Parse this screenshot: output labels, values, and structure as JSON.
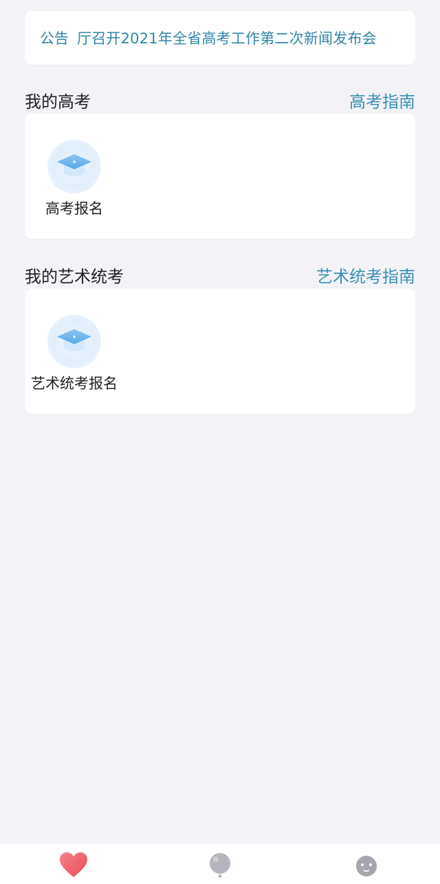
{
  "notice": {
    "label": "公告",
    "text": "厅召开2021年全省高考工作第二次新闻发布会"
  },
  "sections": [
    {
      "title": "我的高考",
      "link": "高考指南",
      "items": [
        {
          "label": "高考报名",
          "icon": "graduation-cap-icon"
        }
      ]
    },
    {
      "title": "我的艺术统考",
      "link": "艺术统考指南",
      "items": [
        {
          "label": "艺术统考报名",
          "icon": "graduation-cap-icon"
        }
      ]
    }
  ],
  "tabbar": {
    "tabs": [
      {
        "icon": "heart-icon",
        "active": true
      },
      {
        "icon": "balloon-icon",
        "active": false
      },
      {
        "icon": "face-icon",
        "active": false
      }
    ]
  },
  "colors": {
    "accent": "#3b8fb5",
    "notice_text": "#2f86a8",
    "background": "#f3f3f8",
    "tab_active": "#ee5a5a",
    "tab_inactive": "#a6a6ae"
  }
}
